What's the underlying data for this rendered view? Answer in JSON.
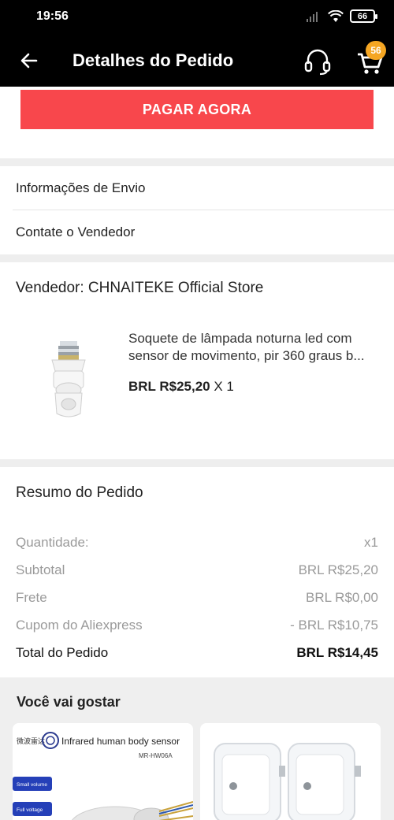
{
  "status_bar": {
    "time": "19:56",
    "battery": "66"
  },
  "app_bar": {
    "title": "Detalhes do Pedido",
    "cart_count": "56"
  },
  "pay_button": "PAGAR AGORA",
  "menu": {
    "shipping_info": "Informações de Envio",
    "contact_seller": "Contate o Vendedor"
  },
  "seller": {
    "label": "Vendedor: CHNAITEKE Official Store"
  },
  "product": {
    "title": "Soquete de lâmpada noturna led com sensor de movimento, pir 360 graus b...",
    "price": "BRL R$25,20",
    "quantity": "X 1"
  },
  "summary": {
    "title": "Resumo do Pedido",
    "rows": [
      {
        "label": "Quantidade:",
        "value": "x1"
      },
      {
        "label": "Subtotal",
        "value": "BRL R$25,20"
      },
      {
        "label": "Frete",
        "value": "BRL R$0,00"
      },
      {
        "label": "Cupom do Aliexpress",
        "value": "- BRL R$10,75"
      }
    ],
    "total": {
      "label": "Total do Pedido",
      "value": "BRL R$14,45"
    }
  },
  "recommendations": {
    "title": "Você vai gostar",
    "items": [
      {
        "heading": "Infrared human body sensor",
        "model": "MR-HW06A",
        "tag1": "Small volume",
        "tag2": "Full voltage"
      },
      {
        "heading": ""
      }
    ]
  },
  "colors": {
    "accent": "#f8474c",
    "badge": "#f5a623"
  }
}
